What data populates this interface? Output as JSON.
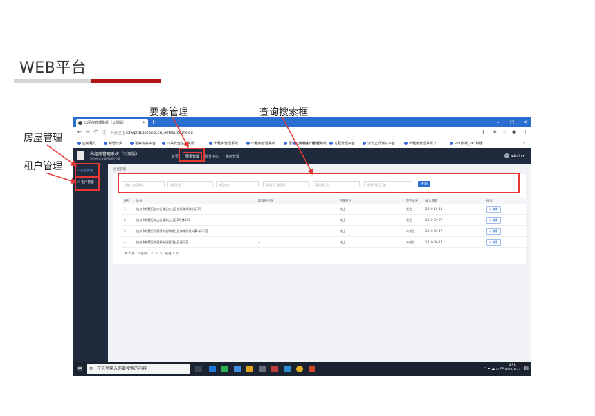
{
  "slide": {
    "title": "WEB平台",
    "callouts": {
      "elements": "要素管理",
      "search": "查询搜索框",
      "house": "房屋管理",
      "tenant": "租户管理"
    }
  },
  "browser": {
    "tab_title": "出租房管理系统（公测版）",
    "new_tab": "+",
    "window_controls": [
      "–",
      "▢",
      "✕"
    ],
    "nav": [
      "←",
      "→",
      "C",
      "ⓘ"
    ],
    "url_warning": "不安全",
    "url": "czwplat.lotone.cn/#/HouseIndex",
    "bookmarks": [
      "应用程式",
      "新增分类",
      "警察说好平台",
      "公共安全信息化服...",
      "出租房管理系统",
      "出租房管理系统",
      "居住证外来人口管理系统",
      "发短信一键通...",
      "龙程管理平台",
      "济宁正式测试平台",
      "出租房管理系统（...",
      "PPT模板_PPT模版..."
    ],
    "bookmarks_more": "»"
  },
  "app": {
    "title": "出租房管理系统（公测版）",
    "subtitle": "济宁市公安局任城区分局",
    "top_nav": [
      "首页",
      "要素管理",
      "统计中心",
      "系统管理"
    ],
    "active_nav": "要素管理",
    "user": "admin ▾",
    "sidebar": [
      "房屋管理",
      "租户管理"
    ],
    "breadcrumb": "房屋管理",
    "filters": {
      "address": "请输入房屋地址",
      "owner": "房屋业主",
      "status": "房屋状态",
      "province": "请选择行政区域",
      "building": "请选择小区",
      "date": "请选择登记日期"
    },
    "query_button": "查询",
    "table": {
      "headers": [
        "序号",
        "地址",
        "建筑物名称",
        "所属社区",
        "是否关注",
        "录入日期",
        "操作"
      ],
      "rows": [
        [
          "1",
          "杭州市拱墅区长庆街道长庆社区东新路绿地小区3号",
          "--",
          "凉山",
          "关注",
          "2019-10-18",
          "◎ 查看"
        ],
        [
          "2",
          "杭州市拱墅区半山街道半山社区2号楼403",
          "--",
          "凉山",
          "关注",
          "2019-09-27",
          "◎ 查看"
        ],
        [
          "3",
          "杭州市拱墅区拱宸桥街道和睦社区和睦新村1幢1单元7室",
          "--",
          "凉山",
          "未关注",
          "2019-09-17",
          "◎ 查看"
        ],
        [
          "4",
          "杭州市拱墅区拱宸桥街道星河社区星河苑",
          "--",
          "凉山",
          "未关注",
          "2019-09-17",
          "◎ 查看"
        ]
      ]
    },
    "pager": {
      "total": "共 4 条",
      "size": "10条/页",
      "prev": "<",
      "page": "1",
      "next": ">",
      "goto": "前往 1 页"
    }
  },
  "taskbar": {
    "search_placeholder": "在这里输入你要搜索的内容",
    "start_icon": "windows-icon",
    "time": "9:56",
    "date": "2020/1/22",
    "tray": "⌃ ⏶ ☁ ▭ 中"
  }
}
